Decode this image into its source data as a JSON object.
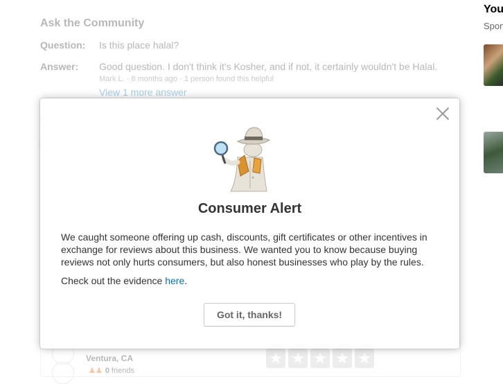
{
  "qa": {
    "title": "Ask the Community",
    "question_label": "Question:",
    "question_text": "Is this place halal?",
    "answer_label": "Answer:",
    "answer_text": "Good question. I don't think it's Kosher, and if not, it certainly wouldn't be Halal.",
    "answer_meta": "Mark L. · 8 months ago · 1 person found this helpful",
    "more_link": "View 1 more answer"
  },
  "sidebar": {
    "title": "You",
    "subtitle": "Spon"
  },
  "review": {
    "location": "Ventura, CA",
    "friends_count": "0",
    "friends_label": "friends"
  },
  "modal": {
    "title": "Consumer Alert",
    "body": "We caught someone offering up cash, discounts, gift certificates or other incentives in exchange for reviews about this business. We wanted you to know because buying reviews not only hurts consumers, but also honest businesses who play by the rules.",
    "evidence_prefix": "Check out the evidence",
    "evidence_link": "here",
    "evidence_suffix": ".",
    "confirm_button": "Got it, thanks!"
  },
  "colors": {
    "link": "#0073bb",
    "text": "#333333",
    "star_empty": "#cccccc"
  }
}
